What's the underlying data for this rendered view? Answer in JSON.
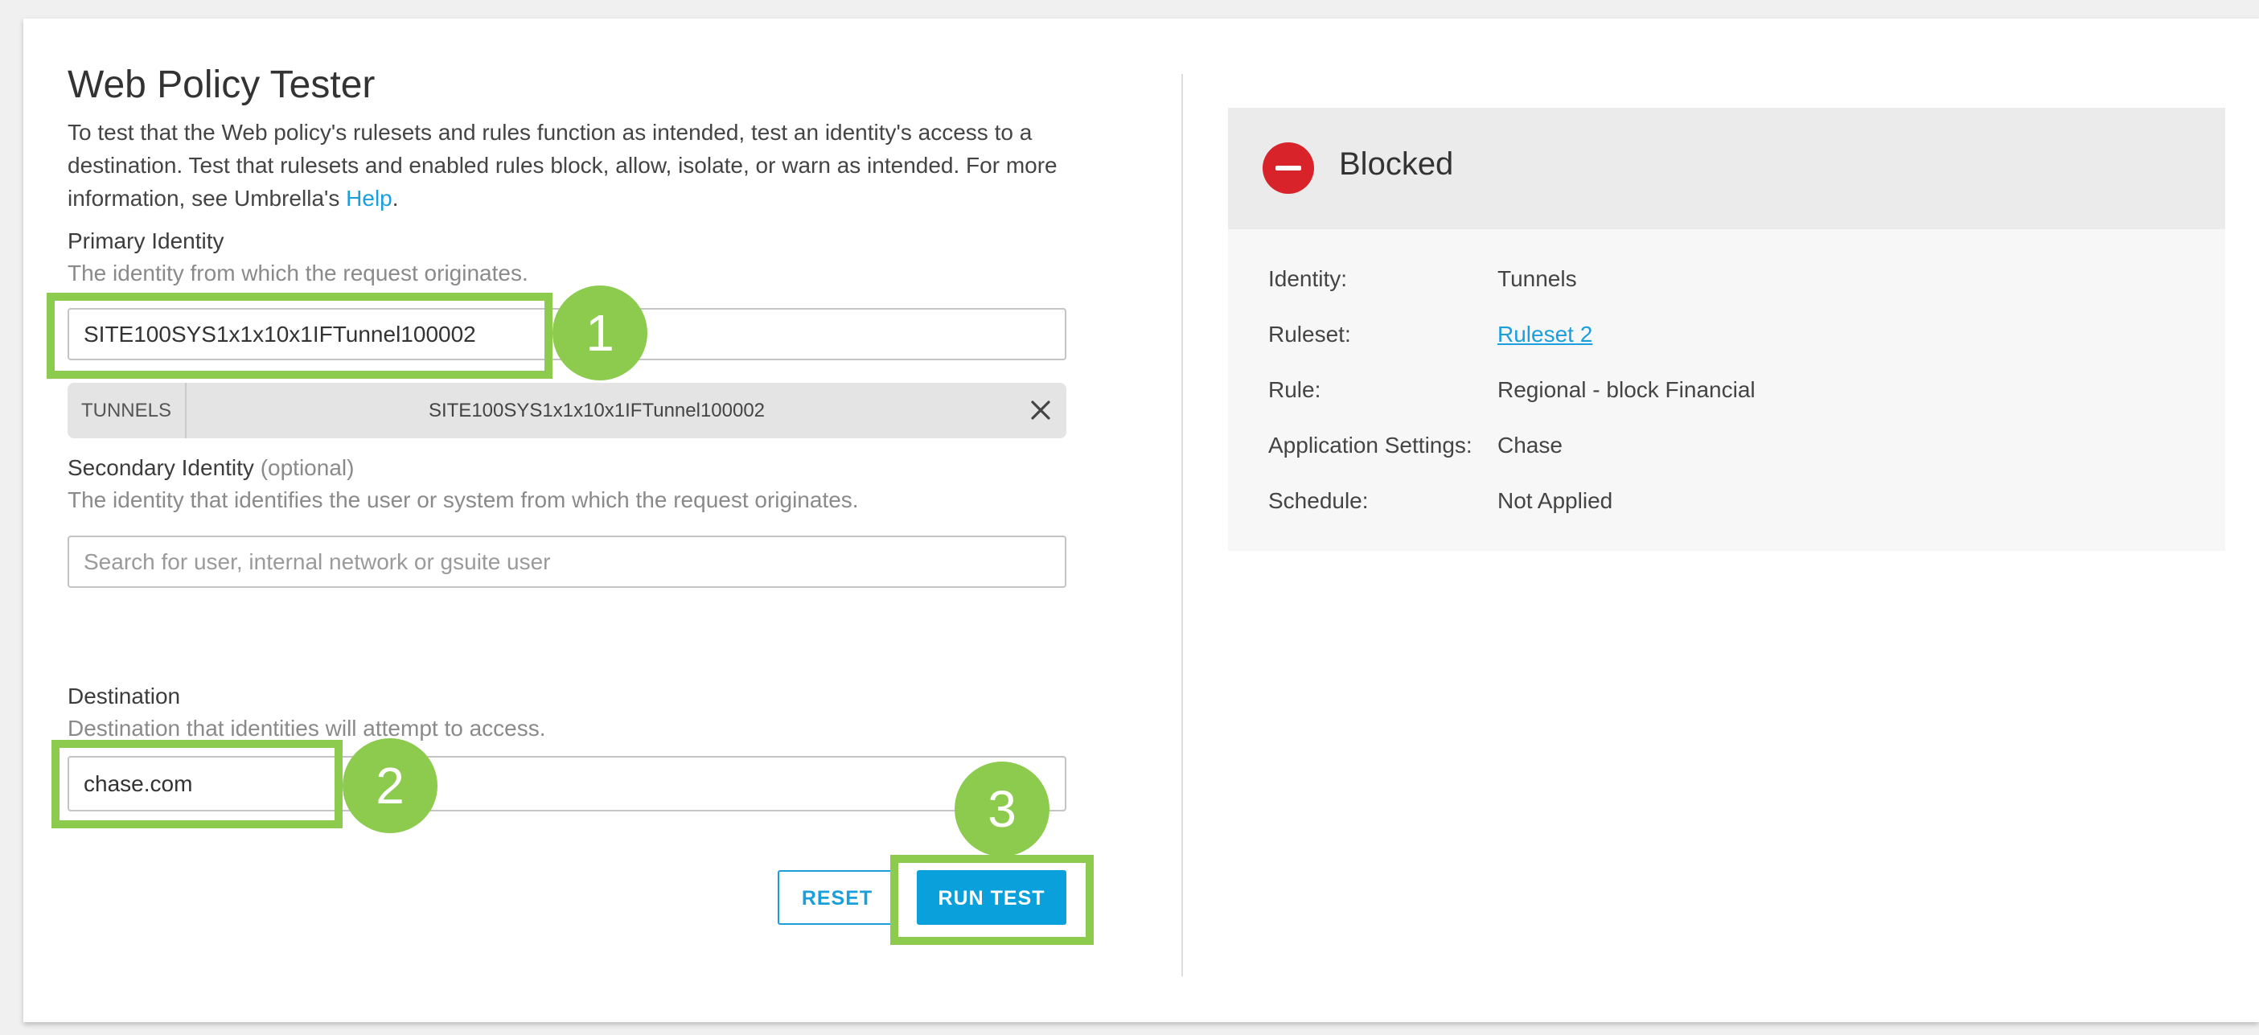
{
  "page": {
    "title": "Web Policy Tester",
    "description_text": "To test that the Web policy's rulesets and rules function as intended, test an identity's access to a destination. Test that rulesets and enabled rules block, allow, isolate, or warn as intended. For more information, see Umbrella's ",
    "help_link": "Help",
    "description_end": "."
  },
  "primary_identity": {
    "label": "Primary Identity",
    "hint": "The identity from which the request originates.",
    "value": "SITE100SYS1x1x10x1IFTunnel100002",
    "chip": {
      "type": "TUNNELS",
      "value": "SITE100SYS1x1x10x1IFTunnel100002",
      "remove_icon": "close-icon"
    }
  },
  "secondary_identity": {
    "label": "Secondary Identity",
    "optional": "(optional)",
    "hint": "The identity that identifies the user or system from which the request originates.",
    "placeholder": "Search for user, internal network or gsuite user"
  },
  "destination": {
    "label": "Destination",
    "hint": "Destination that identities will attempt to access.",
    "value": "chase.com"
  },
  "buttons": {
    "reset": "RESET",
    "run_test": "RUN TEST"
  },
  "callouts": [
    "1",
    "2",
    "3"
  ],
  "result": {
    "status": "Blocked",
    "status_icon": "blocked-minus-icon",
    "rows": [
      {
        "label": "Identity:",
        "value": "Tunnels"
      },
      {
        "label": "Ruleset:",
        "value": "Ruleset 2"
      },
      {
        "label": "Rule:",
        "value": "Regional - block Financial"
      },
      {
        "label": "Application Settings:",
        "value": "Chase"
      },
      {
        "label": "Schedule:",
        "value": "Not Applied"
      }
    ]
  },
  "colors": {
    "accent": "#1a9fdc",
    "blocked": "#d8232a",
    "highlight": "#8ccb4e"
  }
}
